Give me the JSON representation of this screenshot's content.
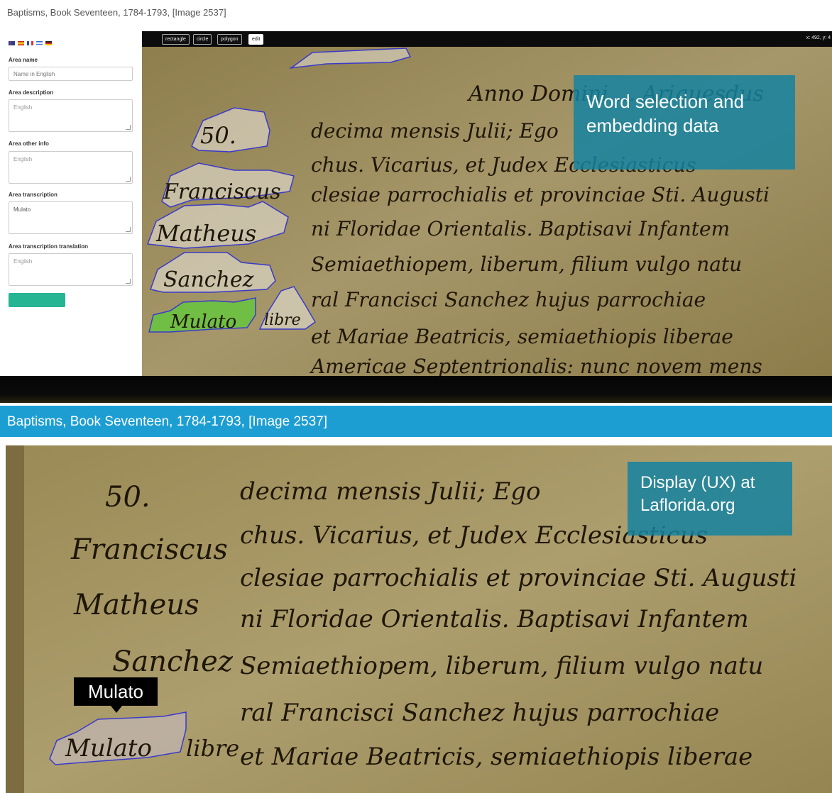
{
  "page_title": "Baptisms, Book Seventeen, 1784-1793, [Image 2537]",
  "editor": {
    "languages": [
      "en-flag",
      "es-flag",
      "fr-flag",
      "gr-flag",
      "de-flag"
    ],
    "fields": {
      "area_name": {
        "label": "Area name",
        "placeholder": "Name in English"
      },
      "area_description": {
        "label": "Area description",
        "placeholder": "English"
      },
      "area_other_info": {
        "label": "Area other info",
        "placeholder": "English"
      },
      "area_transcription": {
        "label": "Area transcription",
        "value": "Mulato"
      },
      "area_transcription_translation": {
        "label": "Area transcription translation",
        "placeholder": "English"
      }
    },
    "toolbar": {
      "rectangle": "rectangle",
      "circle": "circle",
      "polygon": "polygon",
      "edit": "edit",
      "coords": "x: 492, y: 4"
    },
    "callout": {
      "line1": "Word selection and",
      "line2": "embedding data"
    }
  },
  "display": {
    "title": "Baptisms, Book Seventeen, 1784-1793, [Image 2537]",
    "tooltip": "Mulato",
    "callout": {
      "line1": "Display (UX) at",
      "line2": "Laflorida.org"
    }
  },
  "manuscript": {
    "lines": [
      "Anno Domini ... Ariquesdus",
      "decima mensis Julii; Ego",
      "chus. Vicarius, et Judex Ecclesiasticus",
      "clesiae parrochialis et provinciae Sti. Augusti",
      "ni Floridae Orientalis. Baptisavi Infantem",
      "Semiaethiopem, liberum, filium vulgo natu",
      "ral Francisci Sanchez hujus parrochiae",
      "et Mariae Beatricis, semiaethiopis liberae",
      "Americae Septentrionalis: nunc novem mens"
    ],
    "margin": [
      "50.",
      "Franciscus",
      "Matheus",
      "Sanchez",
      "Mulato",
      "libre"
    ]
  },
  "colors": {
    "display_header": "#1d9ed3",
    "callout": "#1482a0",
    "selection_green": "#5dbf3a",
    "polygon_stroke": "#3a3ac8",
    "save_button": "#25b593"
  }
}
